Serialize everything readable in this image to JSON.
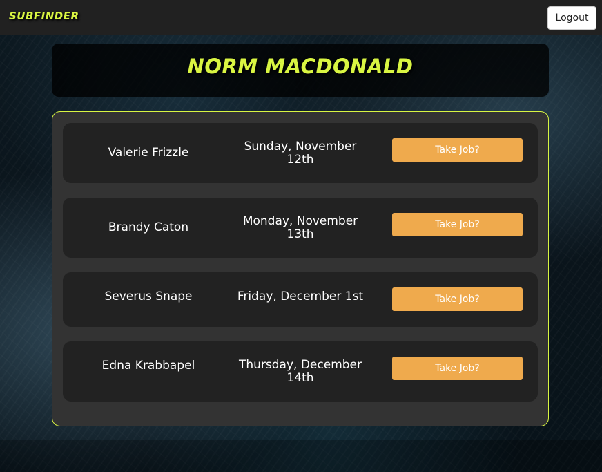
{
  "navbar": {
    "brand": "SUBFINDER",
    "logout_label": "Logout"
  },
  "header": {
    "title": "NORM MACDONALD"
  },
  "jobs": [
    {
      "name": "Valerie Frizzle",
      "date": "Sunday, November 12th",
      "action_label": "Take Job?"
    },
    {
      "name": "Brandy Caton",
      "date": "Monday, November 13th",
      "action_label": "Take Job?"
    },
    {
      "name": "Severus Snape",
      "date": "Friday, December 1st",
      "action_label": "Take Job?"
    },
    {
      "name": "Edna Krabbapel",
      "date": "Thursday, December 14th",
      "action_label": "Take Job?"
    }
  ],
  "colors": {
    "accent": "#d9f542",
    "button": "#efaa4d",
    "panel": "#333333",
    "row": "#222222"
  }
}
